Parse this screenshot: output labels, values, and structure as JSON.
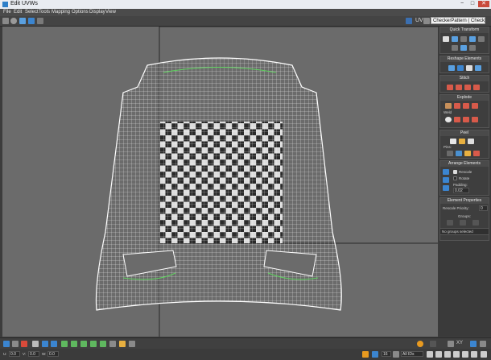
{
  "window": {
    "title": "Edit UVWs",
    "controls": [
      "−",
      "□",
      "✕"
    ]
  },
  "menu": [
    "File",
    "Edit",
    "Select",
    "Tools",
    "Mapping",
    "Options",
    "Display",
    "View"
  ],
  "toolbar": {
    "uv_label": "UV",
    "texture_dropdown": "CheckerPattern ( Checker )"
  },
  "panel": {
    "quick_transform": "Quick Transform",
    "reshape_elements": "Reshape Elements",
    "stitch": "Stitch",
    "explode": "Explode",
    "weld": "Weld",
    "peel": "Peel",
    "pins": "Pins:",
    "arrange_elements": "Arrange Elements",
    "rescale": "Rescale",
    "rotate": "Rotate",
    "padding": "Padding:",
    "padding_value": "0.02",
    "element_properties": "Element Properties",
    "rescale_priority": "Rescale Priority:",
    "rescale_priority_value": "0",
    "groups": "Groups:",
    "group_status": "No groups selected"
  },
  "bottom": {
    "u_label": "U:",
    "u_value": "0.0",
    "v_label": "V:",
    "v_value": "0.0",
    "w_label": "W:",
    "w_value": "0.0",
    "uv_mode": "XY",
    "zoom_value": "16",
    "all_ids": "All IDs"
  },
  "colors": {
    "viewport_bg": "#6b6b6b",
    "mesh": "#ffffff",
    "seam": "#5fd35f",
    "accent": "#2e7fc8"
  }
}
